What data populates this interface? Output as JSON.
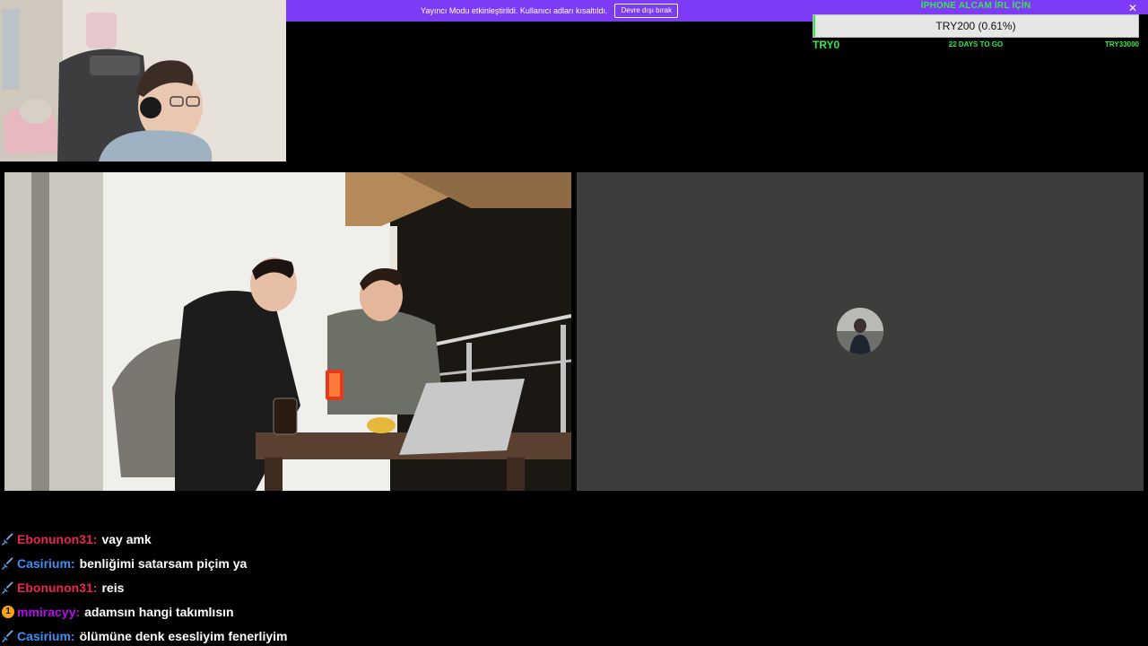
{
  "mod_banner": {
    "text": "Yayıncı Modu etkinleştirildi. Kullanıcı adları kısaltıldı.",
    "button_label": "Devre dışı bırak",
    "close_glyph": "✕",
    "color": "#7d3bf5"
  },
  "goal": {
    "title": "İPHONE ALCAM İRL İÇİN",
    "amount_label": "TRY200 (0.61%)",
    "progress_percent": 0.61,
    "start_label": "TRY0",
    "days_label": "22 DAYS TO GO",
    "target_label": "TRY33000",
    "accent_color": "#37e84a"
  },
  "chat": {
    "messages": [
      {
        "badge": "sword-icon",
        "user": "Ebonunon31",
        "user_color": "#e8264f",
        "text": "vay amk"
      },
      {
        "badge": "sword-icon",
        "user": "Casirium",
        "user_color": "#3d8ff5",
        "text": "benliğimi satarsam piçim ya"
      },
      {
        "badge": "sword-icon",
        "user": "Ebonunon31",
        "user_color": "#e8264f",
        "text": "reis"
      },
      {
        "badge": "gold-badge-icon",
        "badge_text": "1",
        "user": "mmiracyy",
        "user_color": "#b40ee8",
        "text": "adamsın hangi takımlısın"
      },
      {
        "badge": "sword-icon",
        "user": "Casirium",
        "user_color": "#3d8ff5",
        "text": "ölümüne denk esesliyim fenerliyim"
      }
    ]
  }
}
